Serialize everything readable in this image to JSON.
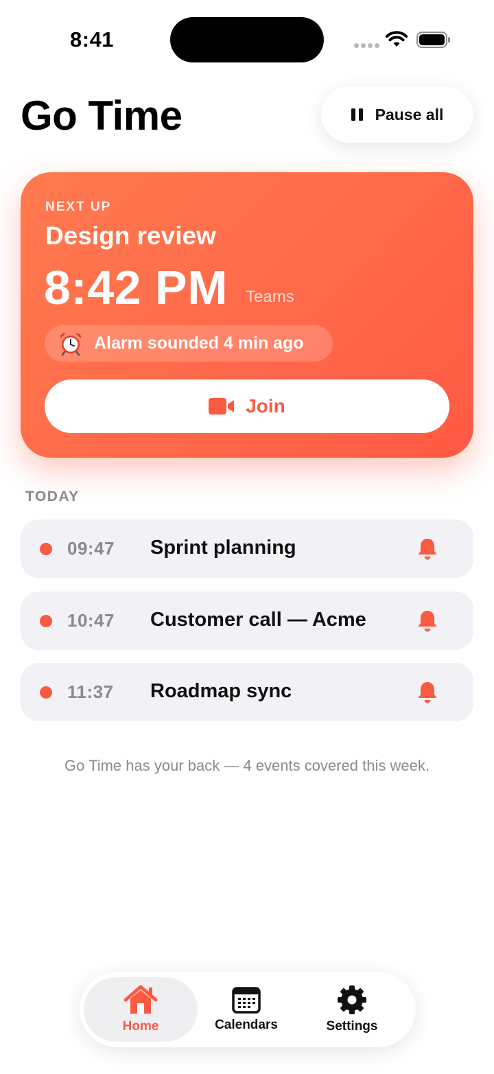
{
  "status_bar": {
    "time": "8:41"
  },
  "header": {
    "title": "Go Time",
    "pause_label": "Pause all"
  },
  "next_up": {
    "label": "NEXT UP",
    "title": "Design review",
    "time": "8:42 PM",
    "platform": "Teams",
    "alarm_text": "Alarm sounded 4 min ago",
    "join_label": "Join"
  },
  "today": {
    "label": "TODAY",
    "events": [
      {
        "time": "09:47",
        "title": "Sprint planning"
      },
      {
        "time": "10:47",
        "title": "Customer call — Acme"
      },
      {
        "time": "11:37",
        "title": "Roadmap sync"
      }
    ]
  },
  "footnote": "Go Time has your back — 4 events covered this week.",
  "tabs": [
    {
      "label": "Home",
      "icon": "home-icon",
      "active": true
    },
    {
      "label": "Calendars",
      "icon": "calendar-icon",
      "active": false
    },
    {
      "label": "Settings",
      "icon": "gear-icon",
      "active": false
    }
  ],
  "colors": {
    "accent": "#fb5a42",
    "card_gradient_start": "#ff7a4f",
    "card_gradient_end": "#ff5a45",
    "row_bg": "#f2f2f6"
  }
}
